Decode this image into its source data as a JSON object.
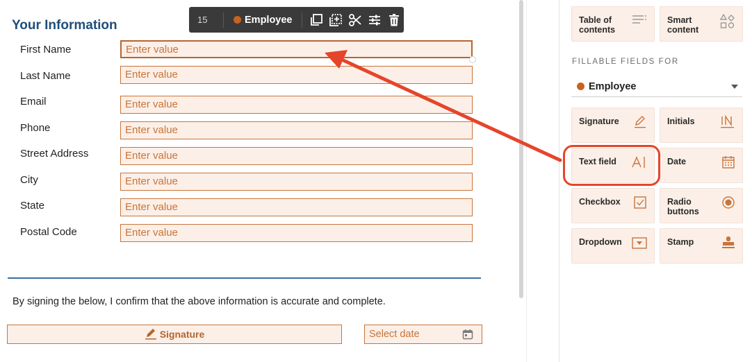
{
  "document": {
    "section_title": "Your Information",
    "fields": [
      {
        "label": "First Name",
        "placeholder": "Enter value"
      },
      {
        "label": "Last Name",
        "placeholder": "Enter value"
      },
      {
        "label": "Email",
        "placeholder": "Enter value"
      },
      {
        "label": "Phone",
        "placeholder": "Enter value"
      },
      {
        "label": "Street Address",
        "placeholder": "Enter value"
      },
      {
        "label": "City",
        "placeholder": "Enter value"
      },
      {
        "label": "State",
        "placeholder": "Enter value"
      },
      {
        "label": "Postal Code",
        "placeholder": "Enter value"
      }
    ],
    "confirm_text": "By signing the below, I confirm that the above information is accurate and complete.",
    "signature_label": "Signature",
    "date_placeholder": "Select date"
  },
  "toolbar": {
    "field_number": "15",
    "role": "Employee",
    "icons": [
      "duplicate-icon",
      "add-field-icon",
      "cut-icon",
      "settings-sliders-icon",
      "delete-icon"
    ]
  },
  "panel": {
    "top_tiles": [
      {
        "label_line1": "Table of",
        "label_line2": "contents",
        "icon": "list-lines-icon"
      },
      {
        "label_line1": "Smart",
        "label_line2": "content",
        "icon": "shapes-icon"
      }
    ],
    "section_header": "FILLABLE FIELDS FOR",
    "role_selected": "Employee",
    "tiles": [
      {
        "label_line1": "Signature",
        "label_line2": "",
        "icon": "pen-icon"
      },
      {
        "label_line1": "Initials",
        "label_line2": "",
        "icon": "initials-icon"
      },
      {
        "label_line1": "Text field",
        "label_line2": "",
        "icon": "text-cursor-icon"
      },
      {
        "label_line1": "Date",
        "label_line2": "",
        "icon": "calendar-icon"
      },
      {
        "label_line1": "Checkbox",
        "label_line2": "",
        "icon": "checkbox-icon"
      },
      {
        "label_line1": "Radio",
        "label_line2": "buttons",
        "icon": "radio-icon"
      },
      {
        "label_line1": "Dropdown",
        "label_line2": "",
        "icon": "dropdown-icon"
      },
      {
        "label_line1": "Stamp",
        "label_line2": "",
        "icon": "stamp-icon"
      }
    ]
  },
  "colors": {
    "accent": "#c8743a",
    "field_fill": "#fcefe7",
    "title_blue": "#1f4e79",
    "annotation_red": "#e5452a",
    "role_dot": "#c8621f"
  }
}
